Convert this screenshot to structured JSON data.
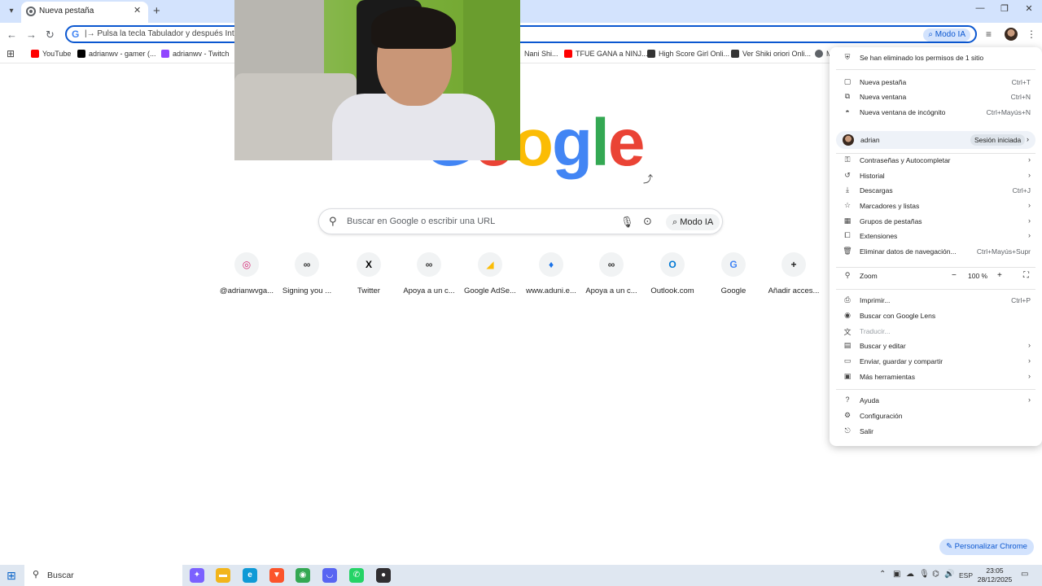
{
  "browser": {
    "tab_title": "Nueva pestaña",
    "tab_close_glyph": "✕",
    "new_tab_glyph": "+",
    "window_buttons": [
      "—",
      "❐",
      "✕"
    ],
    "omnibox_text": "|→ Pulsa la tecla Tabulador y después Intro pa",
    "omnibox_ai_label": "Modo IA",
    "bookmarks": [
      {
        "label": "YouTube",
        "color": "#ff0000"
      },
      {
        "label": "adrianwv - gamer (...",
        "color": "#000000"
      },
      {
        "label": "adrianwv - Twitch",
        "color": "#9146ff"
      },
      {
        "label": "Nani Shi...",
        "color": ""
      },
      {
        "label": "TFUE GANA a NINJ...",
        "color": "#ff0000"
      },
      {
        "label": "High Score Girl Onli...",
        "color": "#333333"
      },
      {
        "label": "Ver Shiki oriori Onli...",
        "color": "#333333"
      },
      {
        "label": "M",
        "color": "#5f6368"
      }
    ]
  },
  "newtab": {
    "logo_letters": [
      {
        "ch": "G",
        "color": "#4285f4"
      },
      {
        "ch": "o",
        "color": "#ea4335"
      },
      {
        "ch": "o",
        "color": "#fbbc05"
      },
      {
        "ch": "g",
        "color": "#4285f4"
      },
      {
        "ch": "l",
        "color": "#34a853"
      },
      {
        "ch": "e",
        "color": "#ea4335"
      }
    ],
    "search_placeholder": "Buscar en Google o escribir una URL",
    "search_ai_label": "Modo IA",
    "shortcuts": [
      {
        "label": "@adrianwvga...",
        "glyph": "◎",
        "color": "#d62976"
      },
      {
        "label": "Signing you ...",
        "glyph": "∞",
        "color": "#333333"
      },
      {
        "label": "Twitter",
        "glyph": "X",
        "color": "#000000"
      },
      {
        "label": "Apoya a un c...",
        "glyph": "∞",
        "color": "#333333"
      },
      {
        "label": "Google AdSe...",
        "glyph": "◢",
        "color": "#fbbc05"
      },
      {
        "label": "www.aduni.e...",
        "glyph": "♦",
        "color": "#1a73e8"
      },
      {
        "label": "Apoya a un c...",
        "glyph": "∞",
        "color": "#333333"
      },
      {
        "label": "Outlook.com",
        "glyph": "O",
        "color": "#0078d4"
      },
      {
        "label": "Google",
        "glyph": "G",
        "color": "#4285f4"
      },
      {
        "label": "Añadir acces...",
        "glyph": "+",
        "color": "#1f1f1f"
      }
    ],
    "customize_label": "✎  Personalizar Chrome"
  },
  "menu": {
    "notice": "Se han eliminado los permisos de 1 sitio",
    "group1": [
      {
        "label": "Nueva pestaña",
        "shortcut": "Ctrl+T",
        "icon": "▢"
      },
      {
        "label": "Nueva ventana",
        "shortcut": "Ctrl+N",
        "icon": "⧉"
      },
      {
        "label": "Nueva ventana de incógnito",
        "shortcut": "Ctrl+Mayús+N",
        "icon": "◓"
      }
    ],
    "profile": {
      "name": "adrian",
      "status": "Sesión iniciada"
    },
    "group2": [
      {
        "label": "Contraseñas y Autocompletar",
        "shortcut": "",
        "arrow": true,
        "icon": "⚿"
      },
      {
        "label": "Historial",
        "shortcut": "",
        "arrow": true,
        "icon": "↺"
      },
      {
        "label": "Descargas",
        "shortcut": "Ctrl+J",
        "arrow": false,
        "icon": "⤓"
      },
      {
        "label": "Marcadores y listas",
        "shortcut": "",
        "arrow": true,
        "icon": "☆"
      },
      {
        "label": "Grupos de pestañas",
        "shortcut": "",
        "arrow": true,
        "icon": "▦"
      },
      {
        "label": "Extensiones",
        "shortcut": "",
        "arrow": true,
        "icon": "⧠"
      },
      {
        "label": "Eliminar datos de navegación...",
        "shortcut": "Ctrl+Mayús+Supr",
        "arrow": false,
        "icon": "🗑"
      }
    ],
    "zoom": {
      "label": "Zoom",
      "minus": "−",
      "value": "100 %",
      "plus": "+",
      "fullscreen": "⛶"
    },
    "group3": [
      {
        "label": "Imprimir...",
        "shortcut": "Ctrl+P",
        "arrow": false,
        "disabled": false,
        "icon": "⎙"
      },
      {
        "label": "Buscar con Google Lens",
        "shortcut": "",
        "arrow": false,
        "disabled": false,
        "icon": "◉"
      },
      {
        "label": "Traducir...",
        "shortcut": "",
        "arrow": false,
        "disabled": true,
        "icon": "文"
      },
      {
        "label": "Buscar y editar",
        "shortcut": "",
        "arrow": true,
        "disabled": false,
        "icon": "▤"
      },
      {
        "label": "Enviar, guardar y compartir",
        "shortcut": "",
        "arrow": true,
        "disabled": false,
        "icon": "▭"
      },
      {
        "label": "Más herramientas",
        "shortcut": "",
        "arrow": true,
        "disabled": false,
        "icon": "▣"
      }
    ],
    "group4": [
      {
        "label": "Ayuda",
        "arrow": true,
        "icon": "?"
      },
      {
        "label": "Configuración",
        "arrow": false,
        "icon": "⚙"
      },
      {
        "label": "Salir",
        "arrow": false,
        "icon": "⎋"
      }
    ],
    "arrow_glyph": "›"
  },
  "taskbar": {
    "search_label": "Buscar",
    "apps": [
      {
        "name": "copilot",
        "color": "#7b61ff",
        "glyph": "✦"
      },
      {
        "name": "explorer",
        "color": "#f2b51c",
        "glyph": "▬"
      },
      {
        "name": "edge",
        "color": "#0f9ad6",
        "glyph": "e"
      },
      {
        "name": "brave",
        "color": "#fb542b",
        "glyph": "▼"
      },
      {
        "name": "chrome",
        "color": "#34a853",
        "glyph": "◉"
      },
      {
        "name": "discord",
        "color": "#5865f2",
        "glyph": "◡"
      },
      {
        "name": "whatsapp",
        "color": "#25d366",
        "glyph": "✆"
      },
      {
        "name": "obs",
        "color": "#302e31",
        "glyph": "●"
      }
    ],
    "language": "ESP",
    "time": "23:05",
    "date": "28/12/2025"
  }
}
